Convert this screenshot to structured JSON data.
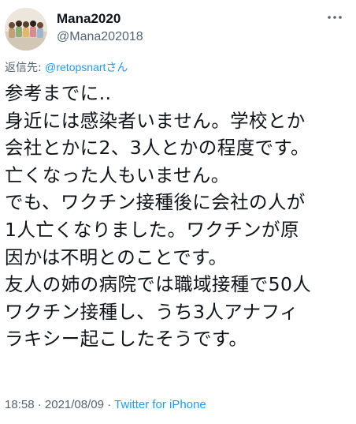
{
  "tweet": {
    "display_name": "Mana2020",
    "handle": "@Mana202018",
    "reply_prefix": "返信先: ",
    "reply_mention": "@retopsnartさん",
    "lines": [
      "参考までに‥",
      "身近には感染者いません。学校とか",
      "会社とかに2、3人とかの程度です。",
      "亡くなった人もいません。",
      "でも、ワクチン接種後に会社の人が",
      "1人亡くなりました。ワクチンが原",
      "因かは不明とのことです。",
      "友人の姉の病院では職域接種で50人",
      "ワクチン接種し、うち3人アナフィ",
      "ラキシー起こしたそうです。"
    ],
    "time": "18:58",
    "separator": " · ",
    "date": "2021/08/09",
    "source": "Twitter for iPhone"
  },
  "icons": {
    "more": "more-dots-icon",
    "avatar": "group-photo-avatar"
  },
  "colors": {
    "text": "#0f1419",
    "secondary": "#536471",
    "link": "#1d9bf0",
    "background": "#ffffff"
  }
}
